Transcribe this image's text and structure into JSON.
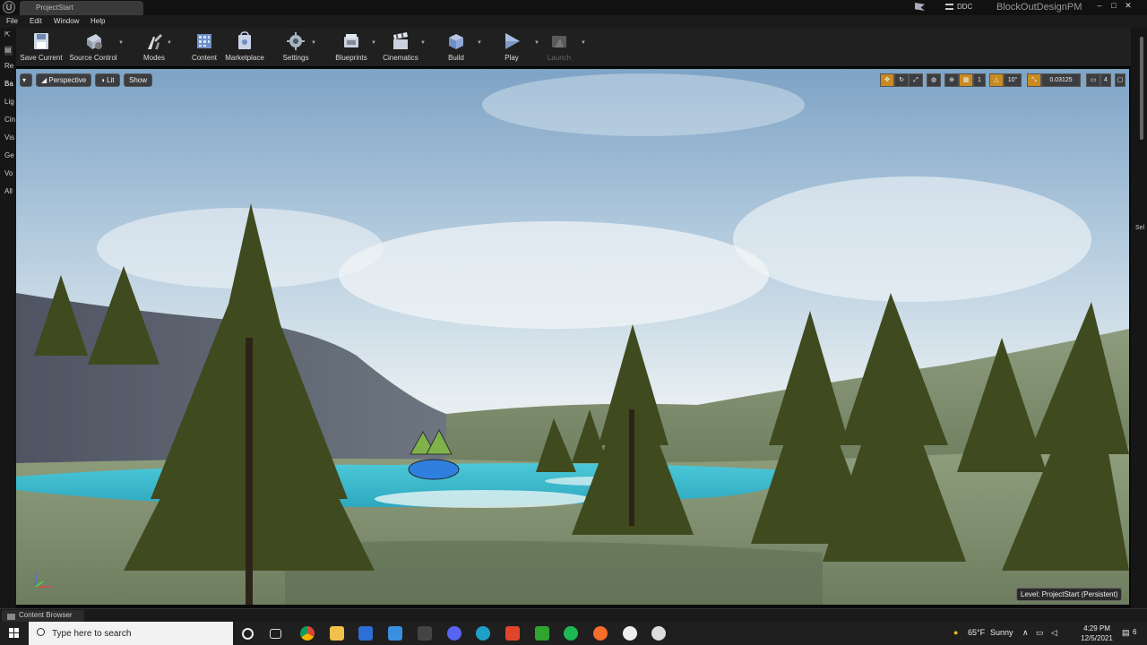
{
  "window": {
    "tab_title": "ProjectStart",
    "ddc_label": "DDC",
    "project_name": "BlockOutDesignPM"
  },
  "menu": [
    "File",
    "Edit",
    "Window",
    "Help"
  ],
  "toolbar": {
    "buttons": [
      {
        "label": "Save Current",
        "icon": "save-icon"
      },
      {
        "label": "Source Control",
        "icon": "source-control-icon"
      },
      {
        "label": "Modes",
        "icon": "modes-icon"
      },
      {
        "label": "Content",
        "icon": "content-icon"
      },
      {
        "label": "Marketplace",
        "icon": "marketplace-icon"
      },
      {
        "label": "Settings",
        "icon": "settings-icon"
      },
      {
        "label": "Blueprints",
        "icon": "blueprints-icon"
      },
      {
        "label": "Cinematics",
        "icon": "cinematics-icon"
      },
      {
        "label": "Build",
        "icon": "build-icon"
      },
      {
        "label": "Play",
        "icon": "play-icon"
      },
      {
        "label": "Launch",
        "icon": "launch-icon"
      }
    ]
  },
  "left_panel_tabs": [
    "Re",
    "Ba",
    "Lig",
    "Cin",
    "Vis",
    "Ge",
    "Vo",
    "All"
  ],
  "right_panel_labels": [
    "Sel"
  ],
  "viewport": {
    "perspective_label": "Perspective",
    "lit_label": "Lit",
    "show_label": "Show",
    "grid_snap": "1",
    "rotation_snap": "10°",
    "scale_snap": "0.03125",
    "camera_speed": "4",
    "level_label": "Level:  ProjectStart (Persistent)"
  },
  "content_browser": {
    "tab_label": "Content Browser"
  },
  "taskbar": {
    "search_placeholder": "Type here to search",
    "weather_temp": "65°F",
    "weather_text": "Sunny",
    "time": "4:29 PM",
    "date": "12/5/2021",
    "notification_count": "6",
    "apps": [
      "cortana-icon",
      "task-view-icon",
      "chrome-icon",
      "file-explorer-icon",
      "store-icon",
      "mail-icon",
      "3d-app-icon",
      "discord-icon",
      "edge-icon",
      "office-icon",
      "xbox-icon",
      "spotify-icon",
      "origin-icon",
      "unreal-icon",
      "steam-icon"
    ]
  }
}
